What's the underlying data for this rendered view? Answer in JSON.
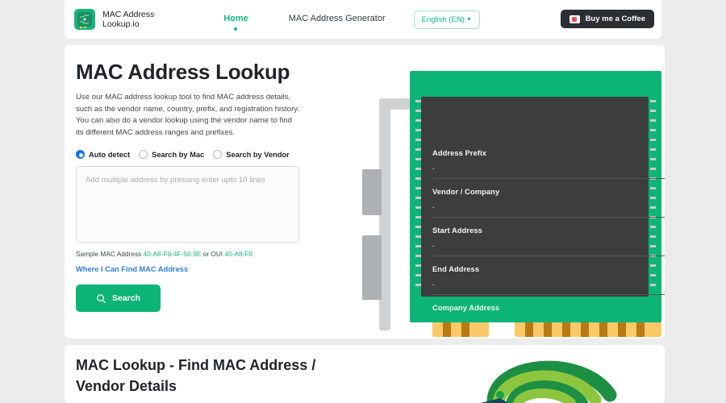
{
  "header": {
    "logo_icon": "circuit-chip-icon",
    "brand_name": "MAC Address\nLookup.io",
    "nav": [
      {
        "label": "Home",
        "active": true
      },
      {
        "label": "MAC Address Generator",
        "active": false
      }
    ],
    "language": {
      "label": "English (EN)",
      "caret": "▼"
    },
    "coffee_button": {
      "label": "Buy me a Coffee",
      "icon": "coffee-cup-icon"
    }
  },
  "main": {
    "title": "MAC Address Lookup",
    "description": "Use our MAC address lookup tool to find MAC address details, such as the vendor name, country, prefix, and registration history. You can also do a vendor lookup using the vendor name to find its different MAC address ranges and prefixes.",
    "search_modes": [
      {
        "label": "Auto detect",
        "selected": true
      },
      {
        "label": "Search by Mac",
        "selected": false
      },
      {
        "label": "Search by Vendor",
        "selected": false
      }
    ],
    "textarea": {
      "value": "",
      "placeholder": "Add multiple address by pressing enter upto 10 lines"
    },
    "sample": {
      "prefix_text": "Sample MAC Address ",
      "mac": "40-A8-F0-4F-50-9E",
      "middle_text": " or OUI ",
      "oui": "40-A8-F0"
    },
    "find_link": "Where I Can Find MAC Address",
    "search_button": {
      "label": "Search",
      "icon": "search-icon"
    }
  },
  "result_panel": {
    "fields": [
      {
        "label": "Address Prefix",
        "value": "-"
      },
      {
        "label": "Vendor / Company",
        "value": "-"
      },
      {
        "label": "Start Address",
        "value": "-"
      },
      {
        "label": "End Address",
        "value": "-"
      },
      {
        "label": "Company Address",
        "value": "-"
      }
    ]
  },
  "bottom": {
    "title": "MAC Lookup - Find MAC Address / Vendor Details",
    "graphic": "wifi-signal-icon"
  },
  "colors": {
    "brand_green": "#0cb577",
    "nav_active": "#10b981",
    "radio_blue": "#0d6efd",
    "link_blue": "#2f7fe0",
    "panel_dark": "#3b3d3e",
    "page_bg": "#ececed",
    "gold": "#fbc968"
  }
}
